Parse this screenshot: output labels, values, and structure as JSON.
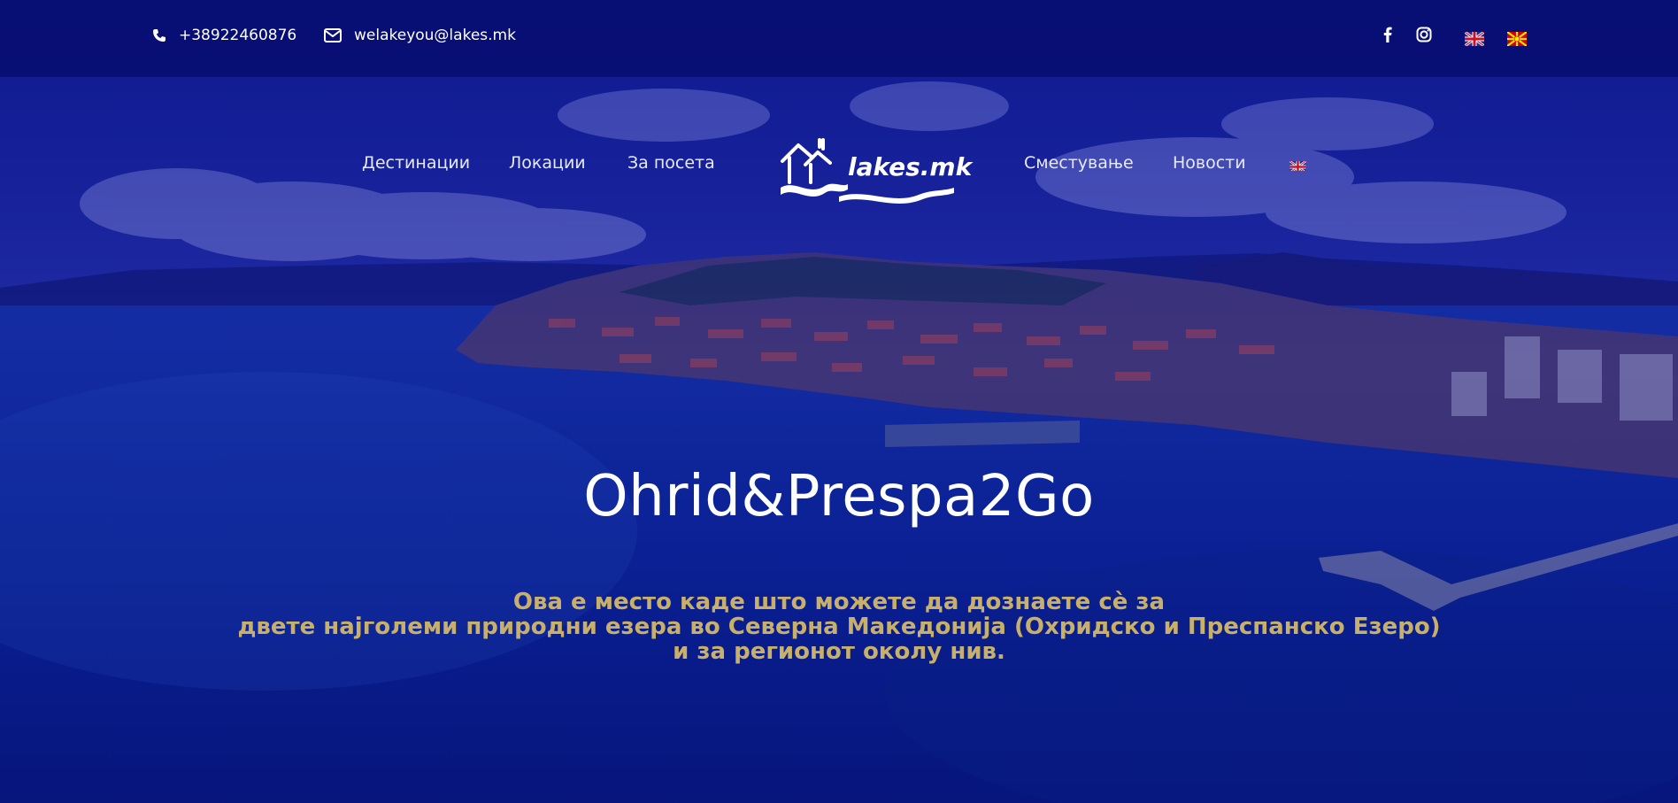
{
  "topbar": {
    "phone": "+38922460876",
    "email": "welakeyou@lakes.mk",
    "phone_icon": "phone-icon",
    "email_icon": "envelope-icon",
    "social": [
      "facebook-icon",
      "instagram-icon"
    ],
    "languages": [
      "English",
      "Македонски"
    ]
  },
  "nav": {
    "items": [
      "Дестинации",
      "Локации",
      "За посета",
      "Сместување",
      "Новости"
    ],
    "logo_text": "lakes.mk"
  },
  "hero": {
    "title": "Ohrid&Prespa2Go",
    "subtitle_lines": [
      "Ова е место каде што можете да дознаете сè за",
      "двете најголеми природни езера во Северна Македонија (Охридско и Преспанско Езеро)",
      "и за регионот околу нив."
    ]
  },
  "colors": {
    "overlay": "#0b1a8a",
    "topbar": "#060c6e",
    "subtitle": "#c9b06a",
    "title": "#ffffff"
  }
}
